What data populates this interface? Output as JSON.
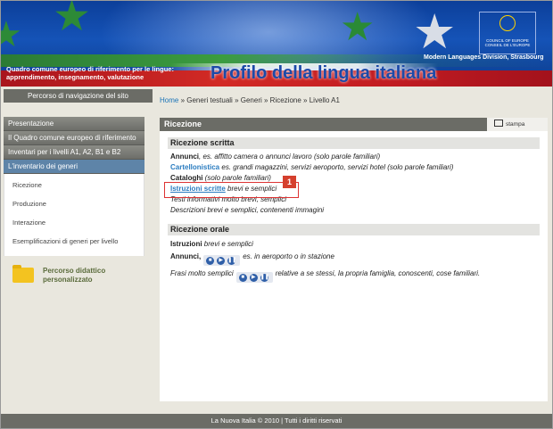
{
  "header": {
    "tagline_line1": "Quadro comune europeo di riferimento per le lingue:",
    "tagline_line2": "apprendimento, insegnamento, valutazione",
    "brand_title": "Profilo della lingua italiana",
    "coe_label_left": "COUNCIL OF EUROPE",
    "coe_label_right": "CONSEIL DE L'EUROPE",
    "division": "Modern Languages Division, Strasbourg"
  },
  "nav": {
    "site_nav_label": "Percorso di navigazione del sito",
    "breadcrumb": [
      "Home",
      "Generi testuali",
      "Generi",
      "Ricezione",
      "Livello A1"
    ],
    "separator": " » "
  },
  "sidebar": {
    "items": [
      {
        "label": "Presentazione"
      },
      {
        "label": "Il Quadro comune europeo di riferimento"
      },
      {
        "label": "Inventari per i livelli A1, A2, B1 e B2"
      },
      {
        "label": "L'inventario dei generi"
      }
    ],
    "subitems": [
      {
        "label": "Ricezione"
      },
      {
        "label": "Produzione"
      },
      {
        "label": "Interazione"
      },
      {
        "label": "Esemplificazioni di generi per livello"
      }
    ],
    "percorso_line1": "Percorso didattico",
    "percorso_line2": "personalizzato"
  },
  "panel": {
    "title": "Ricezione",
    "print_label": "stampa",
    "scritta_title": "Ricezione scritta",
    "scritta": {
      "r1_bold": "Annunci",
      "r1_rest": ", es. affitto camera o annunci lavoro (solo parole familiari)",
      "r2_bold": "Cartellonistica",
      "r2_rest": " es. grandi magazzini, servizi aeroporto, servizi hotel (solo parole familiari)",
      "r3_bold": "Cataloghi",
      "r3_rest": " (solo parole familiari)",
      "r4_link": "Istruzioni scritte",
      "r4_rest": " brevi e semplici",
      "r5": "Testi informativi molto brevi, semplici",
      "r6": "Descrizioni brevi e semplici, contenenti immagini"
    },
    "badge": "1",
    "orale_title": "Ricezione orale",
    "orale": {
      "r1_bold": "Istruzioni",
      "r1_rest": " brevi e semplici",
      "r2_bold": "Annunci,",
      "r2_rest": "es. in aeroporto o in stazione",
      "r3_italic": "Frasi molto semplici",
      "r3_rest": "relative a se stessi, la propria famiglia, conoscenti, cose familiari."
    }
  },
  "footer": {
    "text": "La Nuova Italia © 2010 | Tutti i diritti riservati"
  },
  "colors": {
    "banner_blue": "#1553b7",
    "link_blue": "#2a7cc0",
    "header_gray": "#6b6c66",
    "badge_red": "#d5402e"
  }
}
